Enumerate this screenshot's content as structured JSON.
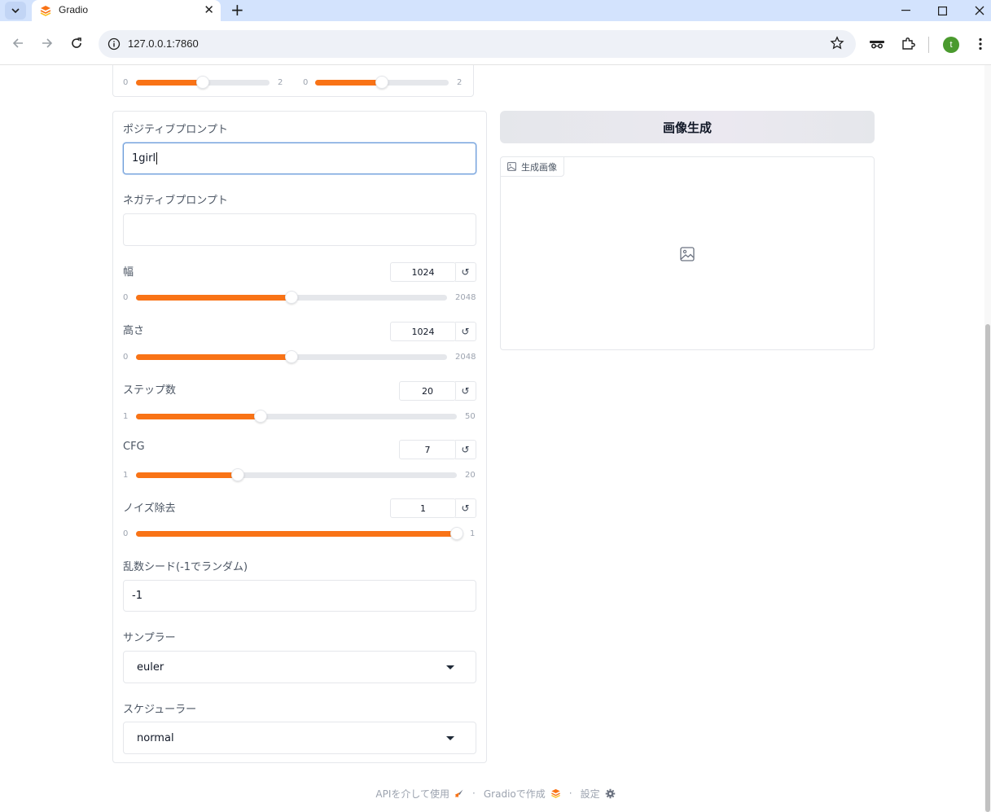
{
  "browser": {
    "tab_title": "Gradio",
    "url": "127.0.0.1:7860",
    "profile_initial": "t"
  },
  "top_sliders": [
    {
      "min": "0",
      "max": "2",
      "fraction": 0.5
    },
    {
      "min": "0",
      "max": "2",
      "fraction": 0.5
    }
  ],
  "positive_prompt": {
    "label": "ポジティブプロンプト",
    "value": "1girl"
  },
  "negative_prompt": {
    "label": "ネガティブプロンプト",
    "value": ""
  },
  "sliders": [
    {
      "key": "width",
      "label": "幅",
      "value": "1024",
      "min": "0",
      "max": "2048",
      "fraction": 0.5
    },
    {
      "key": "height",
      "label": "高さ",
      "value": "1024",
      "min": "0",
      "max": "2048",
      "fraction": 0.5
    },
    {
      "key": "steps",
      "label": "ステップ数",
      "value": "20",
      "min": "1",
      "max": "50",
      "fraction": 0.388
    },
    {
      "key": "cfg",
      "label": "CFG",
      "value": "7",
      "min": "1",
      "max": "20",
      "fraction": 0.316
    },
    {
      "key": "denoise",
      "label": "ノイズ除去",
      "value": "1",
      "min": "0",
      "max": "1",
      "fraction": 1.0
    }
  ],
  "reset_glyph": "↺",
  "seed": {
    "label": "乱数シード(-1でランダム)",
    "value": "-1"
  },
  "sampler": {
    "label": "サンプラー",
    "value": "euler"
  },
  "scheduler": {
    "label": "スケジューラー",
    "value": "normal"
  },
  "generate_button": "画像生成",
  "output_image": {
    "label": "生成画像"
  },
  "footer": {
    "api": "APIを介して使用",
    "built_with": "Gradioで作成",
    "settings": "設定",
    "separator": "·"
  },
  "colors": {
    "accent": "#f97316",
    "tab_strip": "#d3e3fd"
  }
}
